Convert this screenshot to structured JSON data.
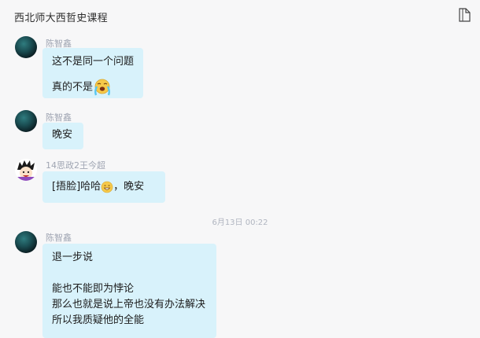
{
  "header": {
    "title": "西北师大西哲史课程",
    "side_icon": "document-icon"
  },
  "messages": [
    {
      "sender": "陈智鑫",
      "avatar": "teal-orb-avatar",
      "line1": "这不是同一个问题",
      "line2": "真的不是",
      "emoji": "crying-emoji"
    },
    {
      "sender": "陈智鑫",
      "avatar": "teal-orb-avatar",
      "line1": "晚安"
    },
    {
      "sender": "14思政2王今超",
      "avatar": "anime-avatar",
      "pre": "[捂脸]哈哈",
      "emoji": "grin-emoji",
      "post": "，晚安"
    },
    {
      "sender": "陈智鑫",
      "avatar": "teal-orb-avatar",
      "line1": "退一步说",
      "line2": "能也不能即为悖论",
      "line3": "那么也就是说上帝也没有办法解决",
      "line4": "所以我质疑他的全能"
    }
  ],
  "timestamp": "6月13日  00:22"
}
